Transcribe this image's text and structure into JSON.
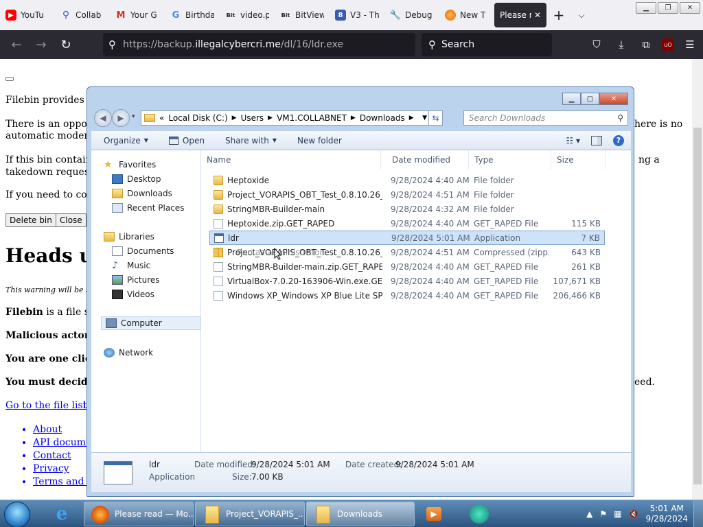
{
  "browser": {
    "tabs": [
      {
        "label": "YouTu",
        "icon": "youtube-icon",
        "color": "#ff0000"
      },
      {
        "label": "Collab",
        "icon": "search-icon",
        "color": "#3b5fc4"
      },
      {
        "label": "Your G",
        "icon": "gmail-icon",
        "color": "#d93025"
      },
      {
        "label": "Birthda",
        "icon": "google-icon",
        "color": "#4285f4"
      },
      {
        "label": "video.p",
        "icon": "bitchute-icon",
        "color": "#333333"
      },
      {
        "label": "BitView",
        "icon": "bitview-icon",
        "color": "#333333"
      },
      {
        "label": "V3 - Th",
        "icon": "v3-icon",
        "color": "#3b5bb5"
      },
      {
        "label": "Debug",
        "icon": "wrench-icon",
        "color": "#333333"
      },
      {
        "label": "New T",
        "icon": "firefox-icon",
        "color": "#e66000"
      },
      {
        "label": "Please r",
        "icon": "",
        "color": "#fbfbfe"
      }
    ],
    "url_prefix": "https://backup.",
    "url_host": "illegalcybercri.me",
    "url_path": "/dl/16/ldr.exe",
    "search_placeholder": "Search"
  },
  "page": {
    "line1": "Filebin provides fi",
    "line2a": "There is an opport",
    "line2b": "automatic moderat",
    "line2r": "here is no",
    "line3a": "If this bin contains",
    "line3b": "takedown request",
    "line3r": "ng a",
    "line4": "If you need to con",
    "delete_btn": "Delete bin",
    "close_btn": "Close",
    "heading": "Heads up",
    "warning": "This warning will be s",
    "filebin_is_b": "Filebin",
    "filebin_is": " is a file sh",
    "malicious": "Malicious actors",
    "one_click": "You are one click",
    "must_decide": "You must decide",
    "must_decide_r": "eed.",
    "go_to": "Go to the file list",
    "go_to_r": "l",
    "links": [
      "About",
      "API docume",
      "Contact",
      "Privacy",
      "Terms and c"
    ]
  },
  "explorer": {
    "path": [
      "Local Disk (C:)",
      "Users",
      "VM1.COLLABNET",
      "Downloads"
    ],
    "search_placeholder": "Search Downloads",
    "commands": {
      "organize": "Organize",
      "open": "Open",
      "share_with": "Share with",
      "new_folder": "New folder"
    },
    "nav": {
      "favorites": "Favorites",
      "desktop": "Desktop",
      "downloads": "Downloads",
      "recent": "Recent Places",
      "libraries": "Libraries",
      "documents": "Documents",
      "music": "Music",
      "pictures": "Pictures",
      "videos": "Videos",
      "computer": "Computer",
      "network": "Network"
    },
    "columns": {
      "name": "Name",
      "date": "Date modified",
      "type": "Type",
      "size": "Size"
    },
    "files": [
      {
        "name": "Heptoxide",
        "date": "9/28/2024 4:40 AM",
        "type": "File folder",
        "size": "",
        "kind": "folder"
      },
      {
        "name": "Project_VORAPIS_OBT_Test_0.8.10.26_(17...",
        "date": "9/28/2024 4:51 AM",
        "type": "File folder",
        "size": "",
        "kind": "folder"
      },
      {
        "name": "StringMBR-Builder-main",
        "date": "9/28/2024 4:32 AM",
        "type": "File folder",
        "size": "",
        "kind": "folder"
      },
      {
        "name": "Heptoxide.zip.GET_RAPED",
        "date": "9/28/2024 4:40 AM",
        "type": "GET_RAPED File",
        "size": "115 KB",
        "kind": "file"
      },
      {
        "name": "ldr",
        "date": "9/28/2024 5:01 AM",
        "type": "Application",
        "size": "7 KB",
        "kind": "app"
      },
      {
        "name": "Project_VORAPIS_OBT_Test_0.8.10.26_(17...",
        "date": "9/28/2024 4:51 AM",
        "type": "Compressed (zipp...",
        "size": "643 KB",
        "kind": "zip"
      },
      {
        "name": "StringMBR-Builder-main.zip.GET_RAPED",
        "date": "9/28/2024 4:40 AM",
        "type": "GET_RAPED File",
        "size": "261 KB",
        "kind": "file"
      },
      {
        "name": "VirtualBox-7.0.20-163906-Win.exe.GET_R...",
        "date": "9/28/2024 4:40 AM",
        "type": "GET_RAPED File",
        "size": "107,671 KB",
        "kind": "file"
      },
      {
        "name": "Windows XP_Windows XP Blue Lite SP3[S...",
        "date": "9/28/2024 4:40 AM",
        "type": "GET_RAPED File",
        "size": "206,466 KB",
        "kind": "file"
      }
    ],
    "ghost_text": "Run as administrator",
    "details": {
      "name": "ldr",
      "kind": "Application",
      "modified_label": "Date modified:",
      "modified": "9/28/2024 5:01 AM",
      "created_label": "Date created:",
      "created": "9/28/2024 5:01 AM",
      "size_label": "Size:",
      "size": "7.00 KB"
    }
  },
  "taskbar": {
    "items": [
      {
        "label": "Please read — Mo...",
        "icon": "firefox-icon"
      },
      {
        "label": "Project_VORAPIS_...",
        "icon": "folder-icon"
      },
      {
        "label": "Downloads",
        "icon": "folder-icon"
      }
    ],
    "time": "5:01 AM",
    "date": "9/28/2024"
  }
}
